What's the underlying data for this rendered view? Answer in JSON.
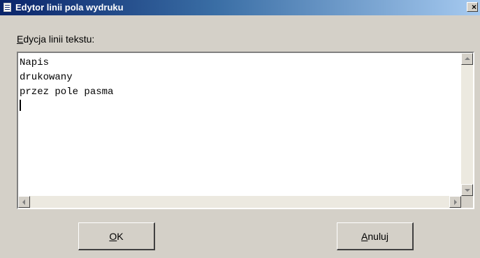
{
  "window": {
    "title": "Edytor linii pola wydruku",
    "close_glyph": "×"
  },
  "editor": {
    "label_mnemonic": "E",
    "label_rest": "dycja linii tekstu:",
    "text": "Napis\ndrukowany\nprzez pole pasma\n"
  },
  "buttons": {
    "ok_mnemonic": "O",
    "ok_rest": "K",
    "cancel_mnemonic": "A",
    "cancel_rest": "nuluj"
  },
  "icons": {
    "title": "document-icon",
    "close": "close-icon",
    "scroll_up": "arrow-up-icon",
    "scroll_down": "arrow-down-icon",
    "scroll_left": "arrow-left-icon",
    "scroll_right": "arrow-right-icon"
  },
  "colors": {
    "titlebar_start": "#0a246a",
    "titlebar_end": "#a6caf0",
    "face": "#d4d0c8"
  }
}
